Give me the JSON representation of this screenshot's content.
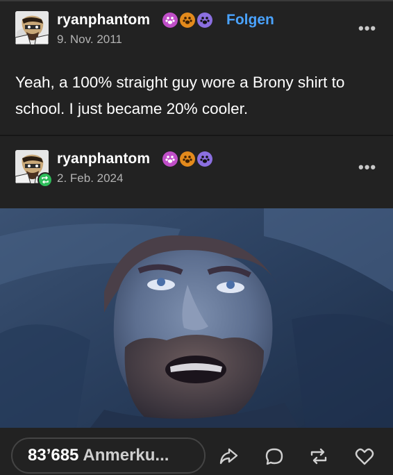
{
  "post1": {
    "username": "ryanphantom",
    "follow_label": "Folgen",
    "date": "9. Nov. 2011",
    "more_label": "•••",
    "text": "Yeah, a 100% straight guy wore a Brony shirt to school. I just became 20% cooler."
  },
  "post2": {
    "username": "ryanphantom",
    "date": "2. Feb. 2024",
    "more_label": "•••"
  },
  "footer": {
    "notes_count": "83’685",
    "notes_label": "Anmerku..."
  },
  "colors": {
    "background": "#222222",
    "link": "#4aa3ff",
    "reblog_badge": "#2fbd5b"
  },
  "icons": [
    "paw-pink-icon",
    "paw-orange-icon",
    "paw-purple-icon",
    "share-icon",
    "reply-icon",
    "reblog-icon",
    "like-icon"
  ]
}
